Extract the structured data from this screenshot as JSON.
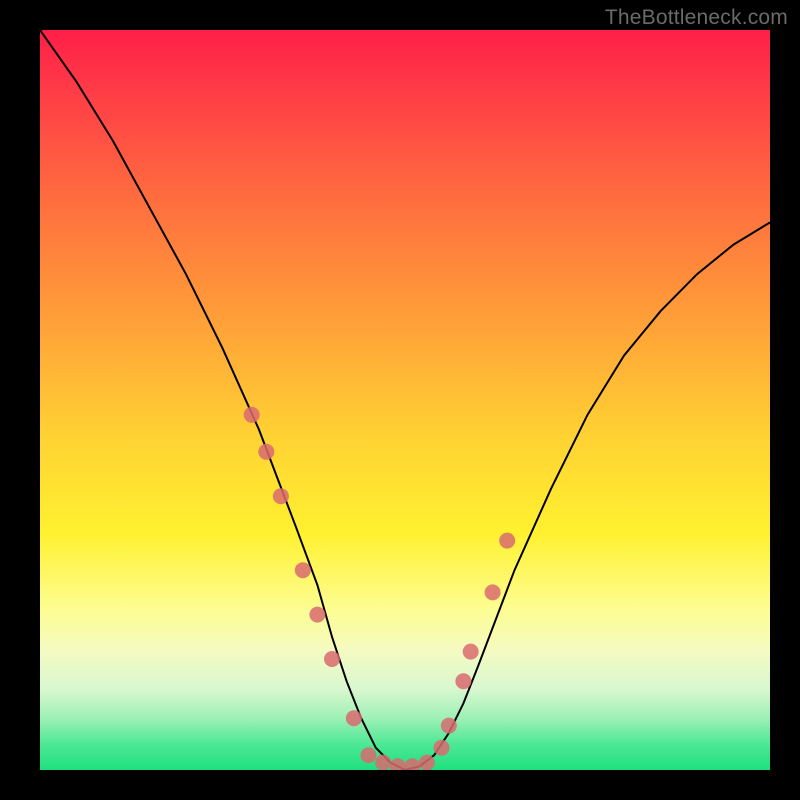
{
  "watermark": "TheBottleneck.com",
  "colors": {
    "background": "#000000",
    "curve": "#000000",
    "marker": "#d96a70",
    "gradient_top": "#ff1f47",
    "gradient_bottom": "#1fe07f"
  },
  "chart_data": {
    "type": "line",
    "title": "",
    "xlabel": "",
    "ylabel": "",
    "xlim": [
      0,
      100
    ],
    "ylim": [
      0,
      100
    ],
    "grid": false,
    "legend": null,
    "series": [
      {
        "name": "bottleneck-curve",
        "x": [
          0,
          5,
          10,
          15,
          20,
          25,
          30,
          35,
          38,
          40,
          42,
          44,
          46,
          48,
          50,
          52,
          54,
          56,
          58,
          60,
          65,
          70,
          75,
          80,
          85,
          90,
          95,
          100
        ],
        "values": [
          100,
          93,
          85,
          76,
          67,
          57,
          46,
          33,
          25,
          18,
          12,
          7,
          3,
          1,
          0,
          0.5,
          2,
          5,
          9,
          14,
          27,
          38,
          48,
          56,
          62,
          67,
          71,
          74
        ]
      }
    ],
    "markers": {
      "name": "highlight-dots",
      "x": [
        29,
        31,
        33,
        36,
        38,
        40,
        43,
        45,
        47,
        49,
        51,
        53,
        55,
        56,
        58,
        59,
        62,
        64
      ],
      "values": [
        48,
        43,
        37,
        27,
        21,
        15,
        7,
        2,
        1,
        0.5,
        0.5,
        1,
        3,
        6,
        12,
        16,
        24,
        31
      ]
    }
  }
}
